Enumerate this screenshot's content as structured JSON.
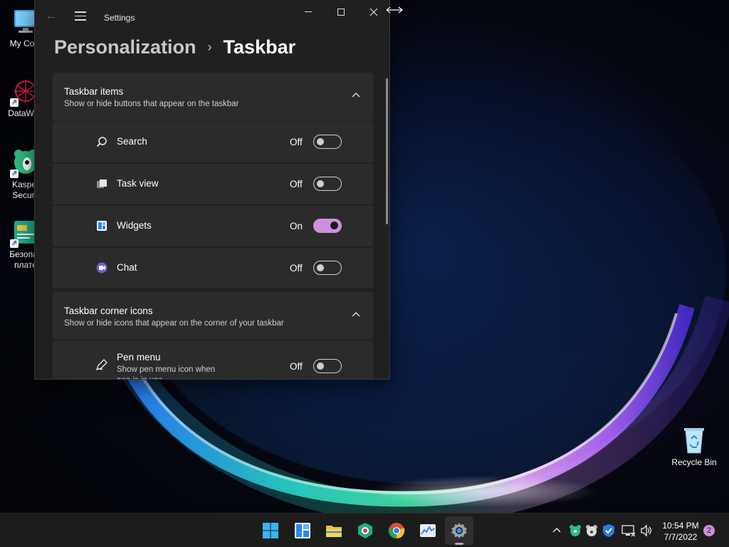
{
  "desktop": {
    "icons": [
      {
        "label": "My Com",
        "name": "my-computer"
      },
      {
        "label": "DataWag",
        "name": "datawag"
      },
      {
        "label": "Kasper",
        "label2": "Securit",
        "name": "kaspersky"
      },
      {
        "label": "Безопас",
        "label2": "плате",
        "name": "safe-payments"
      },
      {
        "label": "Recycle Bin",
        "name": "recycle-bin"
      }
    ]
  },
  "window": {
    "app_title": "Settings",
    "breadcrumb": {
      "parent": "Personalization",
      "separator": "›",
      "current": "Taskbar"
    }
  },
  "sections": {
    "taskbar_items": {
      "title": "Taskbar items",
      "subtitle": "Show or hide buttons that appear on the taskbar",
      "items": [
        {
          "label": "Search",
          "state": "Off",
          "on": false,
          "icon": "search-icon"
        },
        {
          "label": "Task view",
          "state": "Off",
          "on": false,
          "icon": "task-view-icon"
        },
        {
          "label": "Widgets",
          "state": "On",
          "on": true,
          "icon": "widgets-icon"
        },
        {
          "label": "Chat",
          "state": "Off",
          "on": false,
          "icon": "chat-icon"
        }
      ]
    },
    "corner_icons": {
      "title": "Taskbar corner icons",
      "subtitle": "Show or hide icons that appear on the corner of your taskbar",
      "items": [
        {
          "label": "Pen menu",
          "desc": "Show pen menu icon when pen is in use",
          "state": "Off",
          "on": false,
          "icon": "pen-icon"
        }
      ]
    }
  },
  "taskbar": {
    "apps": [
      "start-icon",
      "widgets-icon",
      "file-explorer-icon",
      "kaspersky-icon",
      "chrome-icon",
      "resource-monitor-icon",
      "settings-icon"
    ],
    "active_app": "settings-icon",
    "clock": {
      "time": "10:54 PM",
      "date": "7/7/2022"
    },
    "notifications": "2"
  },
  "colors": {
    "accent": "#d08fdc",
    "window_bg": "#202020",
    "card_bg": "#2b2b2b"
  }
}
